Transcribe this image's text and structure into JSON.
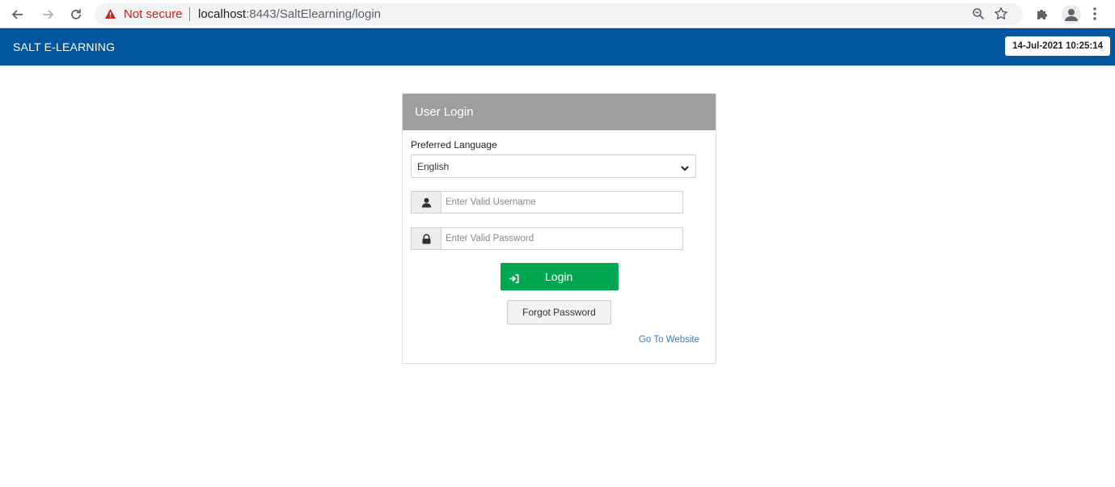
{
  "browser": {
    "security_label": "Not secure",
    "url_host": "localhost",
    "url_rest": ":8443/SaltElearning/login"
  },
  "header": {
    "title": "SALT E-LEARNING",
    "datetime": "14-Jul-2021 10:25:14",
    "bg_color": "#0057a0"
  },
  "login": {
    "heading": "User Login",
    "language_label": "Preferred Language",
    "language_value": "English",
    "username_placeholder": "Enter Valid Username",
    "password_placeholder": "Enter Valid Password",
    "login_label": "Login",
    "forgot_label": "Forgot Password",
    "website_link": "Go To Website",
    "login_color": "#00a650"
  },
  "icons": {
    "back": "arrow-left-icon",
    "forward": "arrow-right-icon",
    "reload": "reload-icon",
    "warning": "warning-triangle-icon",
    "zoom": "zoom-icon",
    "star": "star-icon",
    "extensions": "puzzle-icon",
    "profile": "profile-icon",
    "menu": "kebab-menu-icon",
    "user": "user-icon",
    "lock": "lock-icon",
    "sign_in": "sign-in-icon"
  }
}
